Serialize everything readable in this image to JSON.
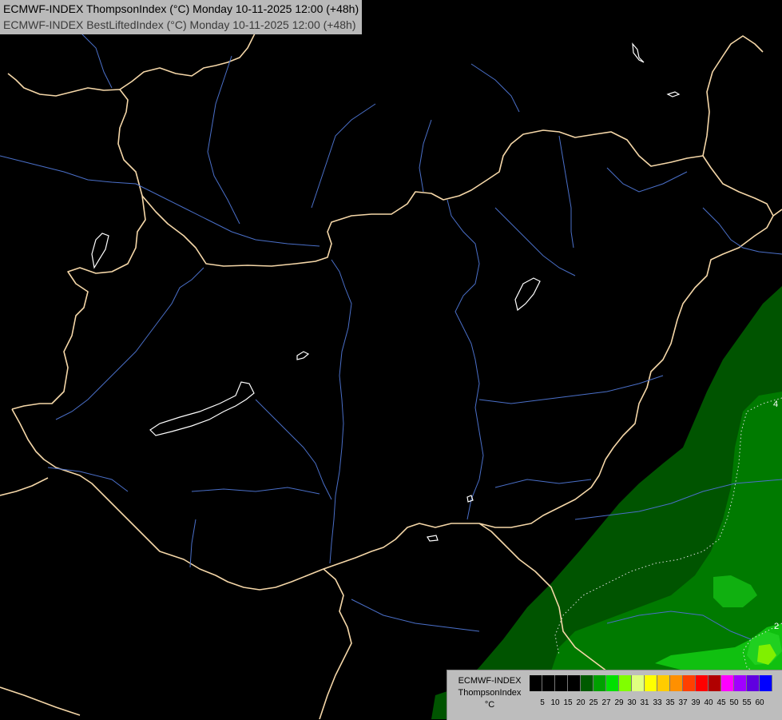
{
  "header": {
    "line1": "ECMWF-INDEX ThompsonIndex (°C) Monday 10-11-2025 12:00 (+48h)",
    "line2": "ECMWF-INDEX BestLiftedIndex (°C) Monday 10-11-2025 12:00 (+48h)"
  },
  "legend": {
    "line1": "ECMWF-INDEX",
    "line2": "ThompsonIndex",
    "unit": "°C",
    "ticks": [
      "5",
      "10",
      "15",
      "20",
      "25",
      "27",
      "29",
      "30",
      "31",
      "33",
      "35",
      "37",
      "39",
      "40",
      "45",
      "50",
      "55",
      "60"
    ],
    "colors": [
      "#000000",
      "#000000",
      "#000000",
      "#000000",
      "#005a00",
      "#00a000",
      "#00e000",
      "#80ff00",
      "#e0ff80",
      "#ffff00",
      "#ffcc00",
      "#ff9000",
      "#ff4000",
      "#ff0000",
      "#b00000",
      "#ff00ff",
      "#a000ff",
      "#6000e0",
      "#0000ff"
    ]
  },
  "contour_labels": [
    "4",
    "2"
  ],
  "colors": {
    "border": "#f5d7a8",
    "river": "#4a6fc8",
    "lake": "#ffffff",
    "field_dark": "#005400",
    "field_mid": "#008800",
    "field_light": "#10c010",
    "field_bright": "#80f000"
  }
}
